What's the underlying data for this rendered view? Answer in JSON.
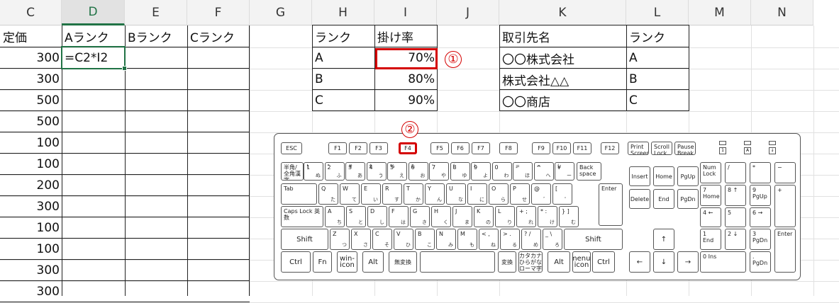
{
  "columns": [
    "C",
    "D",
    "E",
    "F",
    "G",
    "H",
    "I",
    "J",
    "K",
    "L",
    "M",
    "N"
  ],
  "main_table": {
    "headers": [
      "定価",
      "Aランク",
      "Bランク",
      "Cランク"
    ],
    "prices": [
      "300",
      "300",
      "500",
      "500",
      "100",
      "100",
      "200",
      "300",
      "100",
      "100",
      "300",
      "300"
    ],
    "active_cell_formula": "=C2*I2"
  },
  "rate_table": {
    "headers": [
      "ランク",
      "掛け率"
    ],
    "rows": [
      [
        "A",
        "70%"
      ],
      [
        "B",
        "80%"
      ],
      [
        "C",
        "90%"
      ]
    ]
  },
  "client_table": {
    "headers": [
      "取引先名",
      "ランク"
    ],
    "rows": [
      [
        "〇〇株式会社",
        "A"
      ],
      [
        "株式会社△△",
        "B"
      ],
      [
        "〇〇商店",
        "C"
      ]
    ]
  },
  "callouts": [
    "①",
    "②"
  ],
  "colors": {
    "highlight": "#d40000",
    "excel_green": "#217346"
  },
  "keyboard": {
    "function_row": [
      "ESC",
      "F1",
      "F2",
      "F3",
      "F4",
      "F5",
      "F6",
      "F7",
      "F8",
      "F9",
      "F10",
      "F11",
      "F12"
    ],
    "system_keys": [
      "Print Screen",
      "Scroll Lock",
      "Pause Break"
    ],
    "number_row": [
      "半角/全角漢字",
      "1",
      "2",
      "3",
      "4",
      "5",
      "6",
      "7",
      "8",
      "9",
      "0",
      "-",
      "^",
      "¥",
      "Back space"
    ],
    "number_row_kana": [
      "",
      "ぬ",
      "ふ",
      "あ",
      "う",
      "え",
      "お",
      "や",
      "ゆ",
      "よ",
      "わ",
      "ほ",
      "へ",
      "ー",
      ""
    ],
    "number_row_shift": [
      "",
      "!",
      "\"",
      "#",
      "$",
      "%",
      "&",
      "'",
      "(",
      ")",
      "",
      "=",
      "~",
      "|",
      ""
    ],
    "q_row": [
      "Tab",
      "Q",
      "W",
      "E",
      "R",
      "T",
      "Y",
      "U",
      "I",
      "O",
      "P",
      "@",
      "[",
      "Enter"
    ],
    "q_row_kana": [
      "",
      "た",
      "て",
      "い",
      "す",
      "か",
      "ん",
      "な",
      "に",
      "ら",
      "せ",
      "゛",
      "゜",
      ""
    ],
    "a_row": [
      "Caps Lock 英数",
      "A",
      "S",
      "D",
      "F",
      "G",
      "H",
      "J",
      "K",
      "L",
      "+ ;",
      "* :",
      "} ]"
    ],
    "a_row_kana": [
      "",
      "ち",
      "と",
      "し",
      "は",
      "き",
      "く",
      "ま",
      "の",
      "り",
      "れ",
      "け",
      "む"
    ],
    "z_row": [
      "Shift",
      "Z",
      "X",
      "C",
      "V",
      "B",
      "N",
      "M",
      "< ,",
      "> .",
      "? /",
      "_ \\",
      "Shift"
    ],
    "z_row_kana": [
      "",
      "つ",
      "さ",
      "そ",
      "ひ",
      "こ",
      "み",
      "も",
      "ね",
      "る",
      "め",
      "ろ",
      ""
    ],
    "bottom_row": [
      "Ctrl",
      "Fn",
      "win-icon",
      "Alt",
      "無変換",
      "",
      "変換",
      "カタカナ ひらがな ローマ字",
      "Alt",
      "menu-icon",
      "Ctrl"
    ],
    "nav_keys": [
      "Insert",
      "Home",
      "PgUp",
      "Delete",
      "End",
      "PgDn"
    ],
    "arrow_keys": [
      "↑",
      "←",
      "↓",
      "→"
    ],
    "numpad": [
      "Num Lock",
      "/",
      "*",
      "−",
      "7 Home",
      "8 ↑",
      "9 PgUp",
      "+",
      "4 ←",
      "5",
      "6 →",
      "1 End",
      "2 ↓",
      "3 PgDn",
      "Enter",
      "0 Ins",
      ". PgDn"
    ],
    "leds": [
      "1",
      "A",
      "↓"
    ]
  }
}
